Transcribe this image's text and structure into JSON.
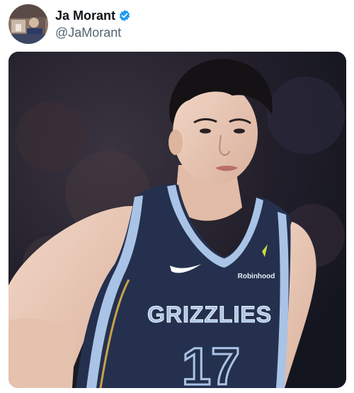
{
  "author": {
    "display_name": "Ja Morant",
    "handle": "@JaMorant",
    "verified": true,
    "avatar_icon": "user-avatar-photo",
    "verified_icon": "verified-badge-icon",
    "verified_color": "#1d9bf0"
  },
  "media": {
    "jersey_text": "GRIZZLIES",
    "jersey_number": "17",
    "sponsor_text": "Robinhood",
    "jersey_color": "#24304d",
    "trim_color": "#a9c3e6",
    "background_color": "#1b1d2a"
  }
}
